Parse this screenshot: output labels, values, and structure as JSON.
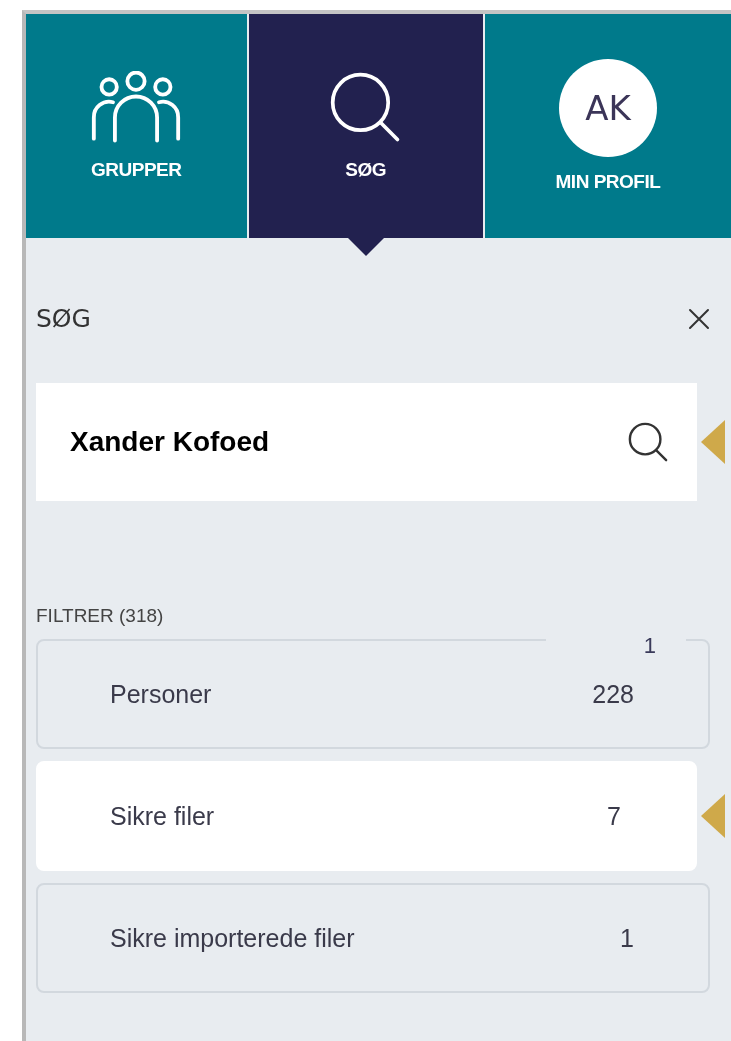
{
  "tabs": [
    {
      "kind": "groups",
      "label": "GRUPPER",
      "selected": false
    },
    {
      "kind": "search",
      "label": "SØG",
      "selected": true
    },
    {
      "kind": "avatar",
      "label": "MIN PROFIL",
      "initials": "AK",
      "selected": false
    }
  ],
  "panel": {
    "title": "SØG",
    "search": {
      "value": "Xander Kofoed"
    },
    "filter_heading": "FILTRER (318)",
    "filters": [
      {
        "label": "Personer",
        "count": "228",
        "selected": false,
        "overlay": "1"
      },
      {
        "label": "Sikre filer",
        "count": "7",
        "selected": true
      },
      {
        "label": "Sikre importerede filer",
        "count": "1",
        "selected": false
      }
    ]
  }
}
